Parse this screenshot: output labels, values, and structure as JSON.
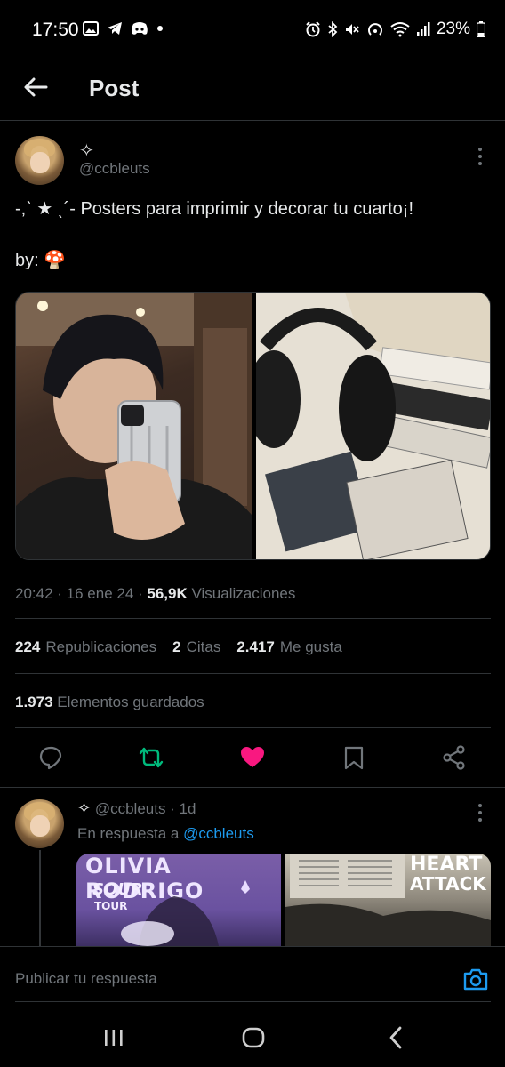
{
  "status_bar": {
    "time": "17:50",
    "battery": "23%",
    "left_icons": [
      "image-icon",
      "telegram-icon",
      "discord-icon",
      "dot-icon"
    ],
    "right_icons": [
      "alarm-icon",
      "bluetooth-icon",
      "mute-icon",
      "hotspot-icon",
      "wifi-icon",
      "signal-icon",
      "battery-icon"
    ]
  },
  "header": {
    "title": "Post"
  },
  "post": {
    "display_name": "✧",
    "handle": "@ccbleuts",
    "text": "-,ˋ ★ ˎ´- Posters para imprimir y decorar tu cuarto¡!",
    "by_label": "by: 🍄",
    "meta": {
      "time_date": "20:42 · 16 ene 24 · ",
      "views_count": "56,9K",
      "views_label": " Visualizaciones"
    },
    "stats": {
      "reposts_count": "224",
      "reposts_label": "Republicaciones",
      "quotes_count": "2",
      "quotes_label": "Citas",
      "likes_count": "2.417",
      "likes_label": "Me gusta"
    },
    "saved": {
      "count": "1.973",
      "label": "Elementos guardados"
    }
  },
  "reply": {
    "star": "✧",
    "handle": "@ccbleuts",
    "time": " · 1d",
    "replying_prefix": "En respuesta a ",
    "replying_to": "@ccbleuts",
    "poster_left_title": "OLIVIA RODRIGO",
    "poster_left_sub": "SOUR",
    "poster_left_tour": "TOUR",
    "poster_right_title1": "HEART",
    "poster_right_title2": "ATTACK"
  },
  "reply_bar": {
    "placeholder": "Publicar tu respuesta"
  },
  "colors": {
    "accent": "#1d9bf0",
    "repost": "#00ba7c",
    "like": "#f91880",
    "text_secondary": "#71767b",
    "border": "#2f3336"
  }
}
